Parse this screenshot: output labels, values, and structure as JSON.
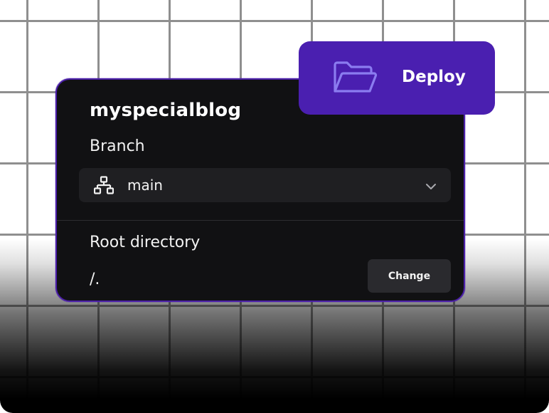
{
  "project": {
    "name": "myspecialblog"
  },
  "branch": {
    "label": "Branch",
    "selected": "main",
    "icon": "branch-icon"
  },
  "root_directory": {
    "label": "Root directory",
    "value": "/.",
    "change_label": "Change"
  },
  "deploy": {
    "label": "Deploy",
    "icon": "folder-open-icon"
  },
  "colors": {
    "accent": "#4a1fb0",
    "card_background": "#111113",
    "card_border": "#4b1fa8",
    "select_background": "#1f1f22",
    "button_background": "#2a2a2e",
    "icon_accent": "#8b7cf0"
  }
}
